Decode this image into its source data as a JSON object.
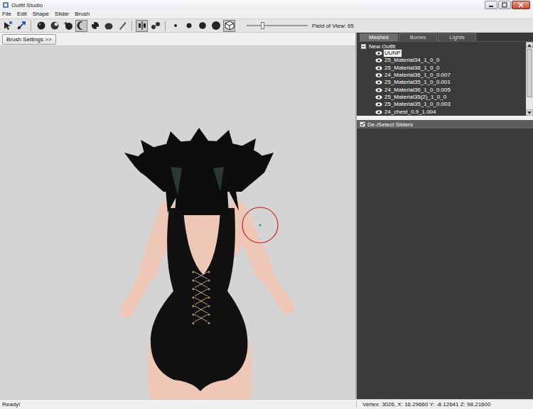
{
  "window": {
    "title": "Outfit Studio"
  },
  "menu": [
    "File",
    "Edit",
    "Shape",
    "Slider",
    "Brush"
  ],
  "toolbar": {
    "tools": [
      {
        "kind": "select",
        "selected": false
      },
      {
        "kind": "transform",
        "selected": false
      },
      {
        "kind": "separator",
        "selected": false
      },
      {
        "kind": "inflate",
        "selected": false
      },
      {
        "kind": "deflate",
        "selected": false
      },
      {
        "kind": "move",
        "selected": false
      },
      {
        "kind": "smooth",
        "selected": true
      },
      {
        "kind": "undiff",
        "selected": false
      },
      {
        "kind": "mask",
        "selected": false
      },
      {
        "kind": "pen",
        "selected": false
      },
      {
        "kind": "separator",
        "selected": false
      },
      {
        "kind": "mirror",
        "selected": true
      },
      {
        "kind": "connected",
        "selected": false
      },
      {
        "kind": "separator",
        "selected": false
      },
      {
        "kind": "dot-s",
        "selected": false
      },
      {
        "kind": "dot-m",
        "selected": false
      },
      {
        "kind": "dot-l",
        "selected": false
      },
      {
        "kind": "dot-xl",
        "selected": false
      },
      {
        "kind": "cube",
        "selected": true
      }
    ],
    "fov": {
      "label": "Field of View: 65",
      "level": 0.25
    }
  },
  "brush_settings": {
    "label": "Brush Settings >>"
  },
  "tabs": [
    {
      "label": "Meshes",
      "selected": true
    },
    {
      "label": "Bones",
      "selected": false
    },
    {
      "label": "Lights",
      "selected": false
    }
  ],
  "tree": {
    "root": {
      "label": "New Outfit",
      "expanded": true
    },
    "items": [
      {
        "label": "UUNP",
        "visible": true,
        "selected": true
      },
      {
        "label": "25_Material34_1_0_0",
        "visible": true,
        "selected": false
      },
      {
        "label": "25_Material38_1_0_0",
        "visible": true,
        "selected": false
      },
      {
        "label": "24_Material36_1_0_0.007",
        "visible": true,
        "selected": false
      },
      {
        "label": "25_Material35_1_0_0.001",
        "visible": true,
        "selected": false
      },
      {
        "label": "24_Material36_1_0_0.005",
        "visible": true,
        "selected": false
      },
      {
        "label": "25_Material35(2)_1_0_0",
        "visible": true,
        "selected": false
      },
      {
        "label": "25_Material35_1_0_0.003",
        "visible": true,
        "selected": false
      },
      {
        "label": "24_chest_0.9_1.004",
        "visible": true,
        "selected": false
      }
    ]
  },
  "sliders": {
    "label": "De-/Select Sliders",
    "checked": true
  },
  "status_bar": {
    "message": "Ready!",
    "vertex": "Vertex: 3026, X: 16.29660 Y: -8.12641 Z: 98.21600"
  }
}
